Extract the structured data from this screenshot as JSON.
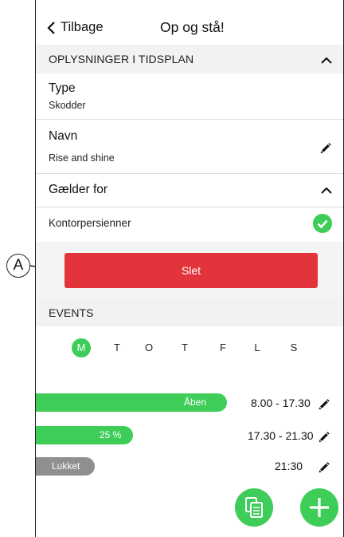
{
  "callout": {
    "letter": "A"
  },
  "header": {
    "back_label": "Tilbage",
    "title": "Op og stå!"
  },
  "schedule_info": {
    "section_label": "OPLYSNINGER I TIDSPLAN",
    "type_label": "Type",
    "type_value": "Skodder",
    "name_label": "Navn",
    "name_value": "Rise and shine",
    "applies_label": "Gælder for",
    "applies_item": "Kontorpersienner"
  },
  "delete_button": "Slet",
  "events": {
    "section_label": "EVENTS",
    "days": [
      "M",
      "T",
      "O",
      "T",
      "F",
      "L",
      "S"
    ],
    "selected_day_index": 0,
    "items": [
      {
        "label": "Åben",
        "time": "8.00 - 17.30",
        "color": "#3dcd58",
        "level": 1.0
      },
      {
        "label": "25 %",
        "time": "17.30 - 21.30",
        "color": "#3dcd58",
        "level": 0.25
      },
      {
        "label": "Lukket",
        "time": "21:30",
        "color": "#8f8f8f",
        "level": 0.0
      }
    ]
  },
  "actions": {
    "copy_icon": "copy-icon",
    "add_icon": "plus-icon"
  },
  "colors": {
    "accent": "#3dcd58",
    "danger": "#e3333b",
    "muted": "#8f8f8f"
  }
}
